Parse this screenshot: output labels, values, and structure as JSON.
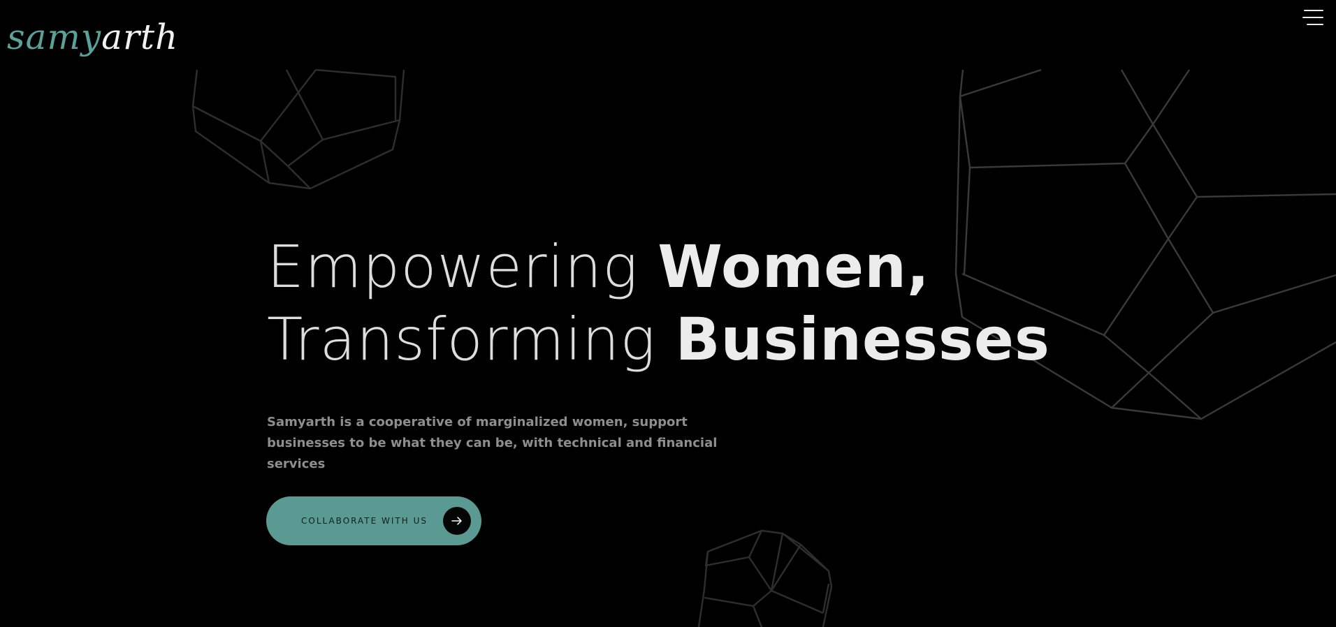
{
  "header": {
    "logo_part1": "samy",
    "logo_part2": "arth",
    "menu_icon": "hamburger-menu-icon"
  },
  "hero": {
    "headline_line1_light": "Empowering ",
    "headline_line1_bold": "Women,",
    "headline_line2_light": "Transforming ",
    "headline_line2_bold": "Businesses",
    "subtitle": "Samyarth is a cooperative of marginalized women, support businesses to be what they can be, with technical and financial services",
    "cta_label": "COLLABORATE WITH US",
    "cta_icon": "arrow-right-icon"
  },
  "colors": {
    "background": "#000000",
    "accent": "#5a9a93",
    "headline": "#e9e9e9",
    "subtitle": "#8e8e8e",
    "wireframe": "#3a3a3a"
  }
}
